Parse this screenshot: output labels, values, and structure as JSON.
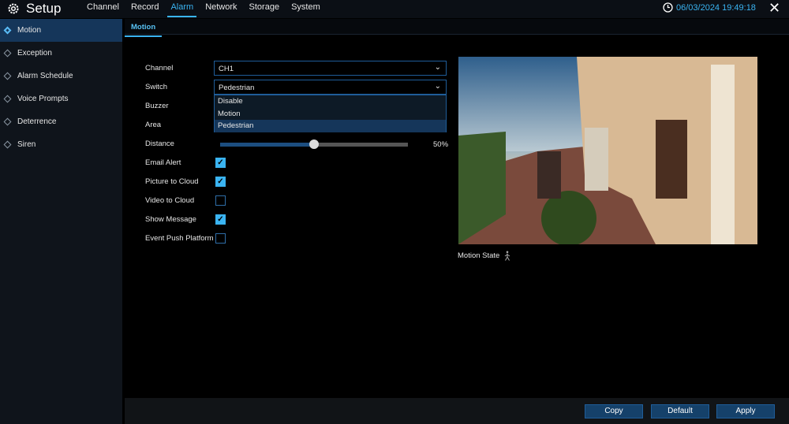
{
  "header": {
    "title": "Setup",
    "icon": "gear-icon",
    "tabs": [
      "Channel",
      "Record",
      "Alarm",
      "Network",
      "Storage",
      "System"
    ],
    "active_tab": "Alarm",
    "datetime": "06/03/2024 19:49:18",
    "accent": "#3ab4f2"
  },
  "sidebar": {
    "items": [
      "Motion",
      "Exception",
      "Alarm Schedule",
      "Voice Prompts",
      "Deterrence",
      "Siren"
    ],
    "active": "Motion"
  },
  "subtab": "Motion",
  "form": {
    "channel_label": "Channel",
    "channel_value": "CH1",
    "switch_label": "Switch",
    "switch_value": "Pedestrian",
    "switch_options": [
      "Disable",
      "Motion",
      "Pedestrian"
    ],
    "buzzer_label": "Buzzer",
    "area_label": "Area",
    "distance_label": "Distance",
    "distance_value": "50%",
    "distance_percent": 50,
    "checkboxes": [
      {
        "label": "Email Alert",
        "checked": true
      },
      {
        "label": "Picture to Cloud",
        "checked": true
      },
      {
        "label": "Video to Cloud",
        "checked": false
      },
      {
        "label": "Show Message",
        "checked": true
      },
      {
        "label": "Event Push Platform",
        "checked": false
      }
    ]
  },
  "preview": {
    "motion_state_label": "Motion State",
    "motion_state_icon": "pedestrian-icon"
  },
  "buttons": {
    "copy": "Copy",
    "default": "Default",
    "apply": "Apply"
  }
}
